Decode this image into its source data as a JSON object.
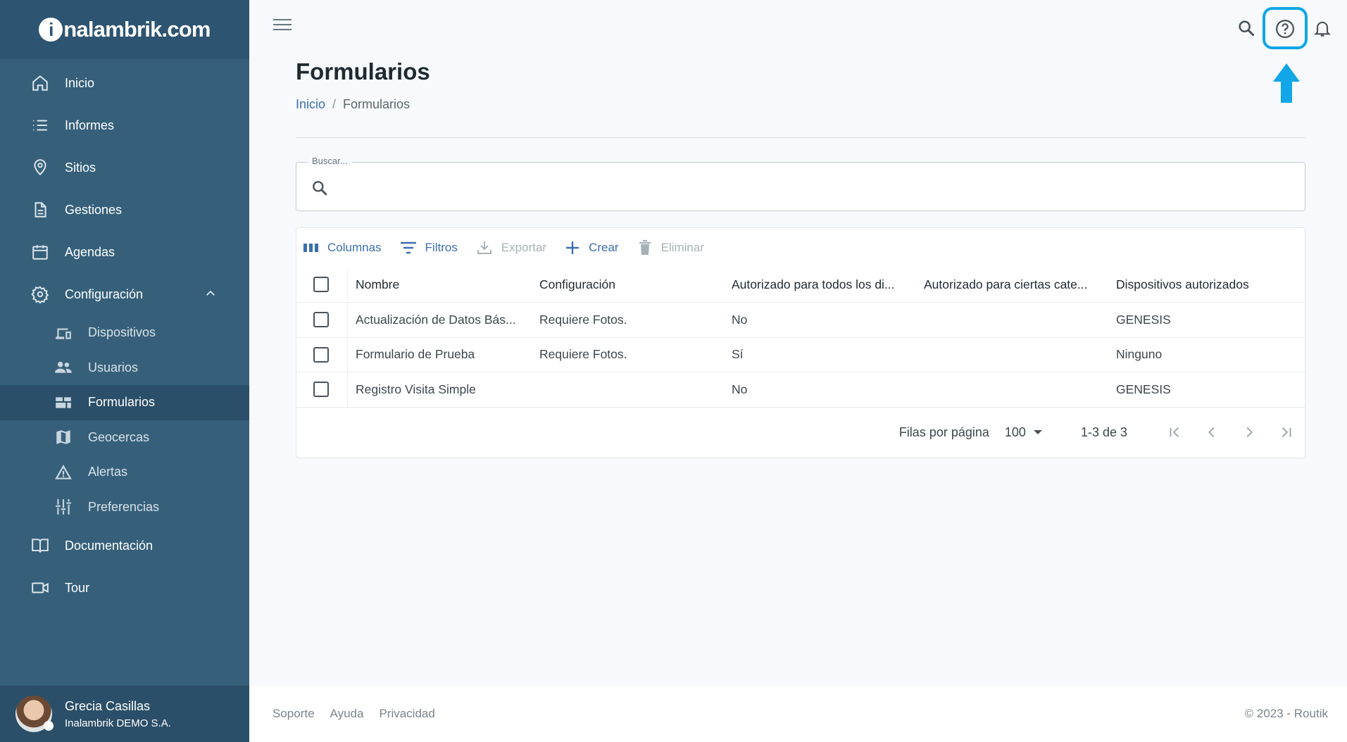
{
  "brand": {
    "logo_i": "i",
    "logo_rest": "nalambrik.com"
  },
  "sidebar": {
    "items": [
      {
        "label": "Inicio",
        "icon": "home-icon"
      },
      {
        "label": "Informes",
        "icon": "list-icon"
      },
      {
        "label": "Sitios",
        "icon": "location-pin-icon"
      },
      {
        "label": "Gestiones",
        "icon": "document-icon"
      },
      {
        "label": "Agendas",
        "icon": "calendar-icon"
      },
      {
        "label": "Configuración",
        "icon": "gear-icon",
        "expanded": true
      }
    ],
    "sub_items": [
      {
        "label": "Dispositivos",
        "icon": "devices-icon"
      },
      {
        "label": "Usuarios",
        "icon": "users-icon"
      },
      {
        "label": "Formularios",
        "icon": "forms-icon",
        "active": true
      },
      {
        "label": "Geocercas",
        "icon": "map-icon"
      },
      {
        "label": "Alertas",
        "icon": "warning-icon"
      },
      {
        "label": "Preferencias",
        "icon": "sliders-icon"
      }
    ],
    "bottom_items": [
      {
        "label": "Documentación",
        "icon": "book-icon"
      },
      {
        "label": "Tour",
        "icon": "video-icon"
      }
    ],
    "user": {
      "name": "Grecia Casillas",
      "org": "Inalambrik DEMO S.A."
    }
  },
  "header": {
    "icons": [
      "menu-icon",
      "search-icon",
      "help-icon",
      "bell-icon"
    ],
    "highlight_color": "#10a6e8"
  },
  "page": {
    "title": "Formularios",
    "breadcrumb": {
      "home": "Inicio",
      "separator": "/",
      "current": "Formularios"
    }
  },
  "search": {
    "label": "Buscar..."
  },
  "toolbar": {
    "columns": "Columnas",
    "filters": "Filtros",
    "export": "Exportar",
    "create": "Crear",
    "delete": "Eliminar"
  },
  "table": {
    "headers": [
      "Nombre",
      "Configuración",
      "Autorizado para todos los di...",
      "Autorizado para ciertas cate...",
      "Dispositivos autorizados"
    ],
    "rows": [
      [
        "Actualización de Datos Bás...",
        "Requiere Fotos.",
        "No",
        "",
        "GENESIS"
      ],
      [
        "Formulario de Prueba",
        "Requiere Fotos.",
        "Sí",
        "",
        "Ninguno"
      ],
      [
        "Registro Visita Simple",
        "",
        "No",
        "",
        "GENESIS"
      ]
    ]
  },
  "pagination": {
    "rows_per_page_label": "Filas por página",
    "rows_per_page": "100",
    "range": "1-3 de 3"
  },
  "footer": {
    "links": [
      "Soporte",
      "Ayuda",
      "Privacidad"
    ],
    "copyright": "© 2023 - Routik"
  }
}
